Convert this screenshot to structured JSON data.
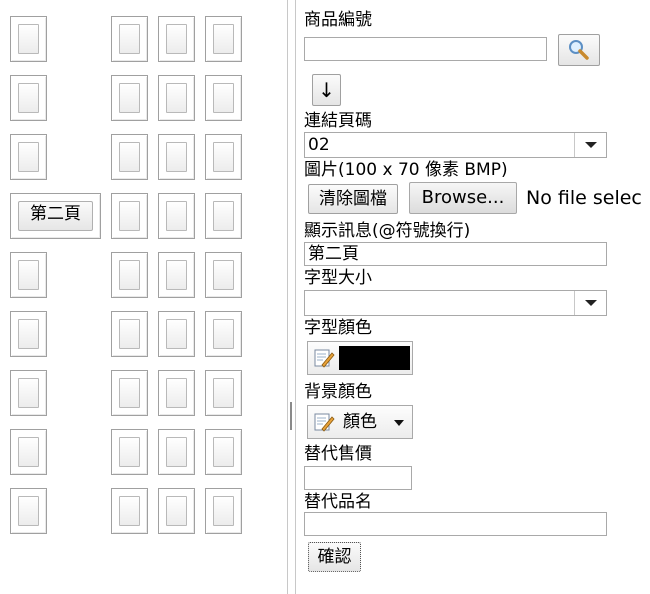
{
  "grid": {
    "button_label": "第二頁"
  },
  "form": {
    "product_code": {
      "label": "商品編號",
      "value": ""
    },
    "search_icon": "search-icon",
    "down_arrow_label": "↓",
    "link_page": {
      "label": "連結頁碼",
      "value": "02"
    },
    "image": {
      "label": "圖片(100 x 70 像素 BMP)",
      "clear_button": "清除圖檔",
      "browse_button": "Browse...",
      "no_file": "No file selec"
    },
    "display_message": {
      "label": "顯示訊息(@符號換行)",
      "value": "第二頁"
    },
    "font_size": {
      "label": "字型大小",
      "value": ""
    },
    "font_color": {
      "label": "字型顏色",
      "value_color": "#000000"
    },
    "background_color": {
      "label": "背景顏色",
      "button_text": "顏色"
    },
    "alt_price": {
      "label": "替代售價",
      "value": ""
    },
    "alt_name": {
      "label": "替代品名",
      "value": ""
    },
    "confirm_button": "確認"
  }
}
